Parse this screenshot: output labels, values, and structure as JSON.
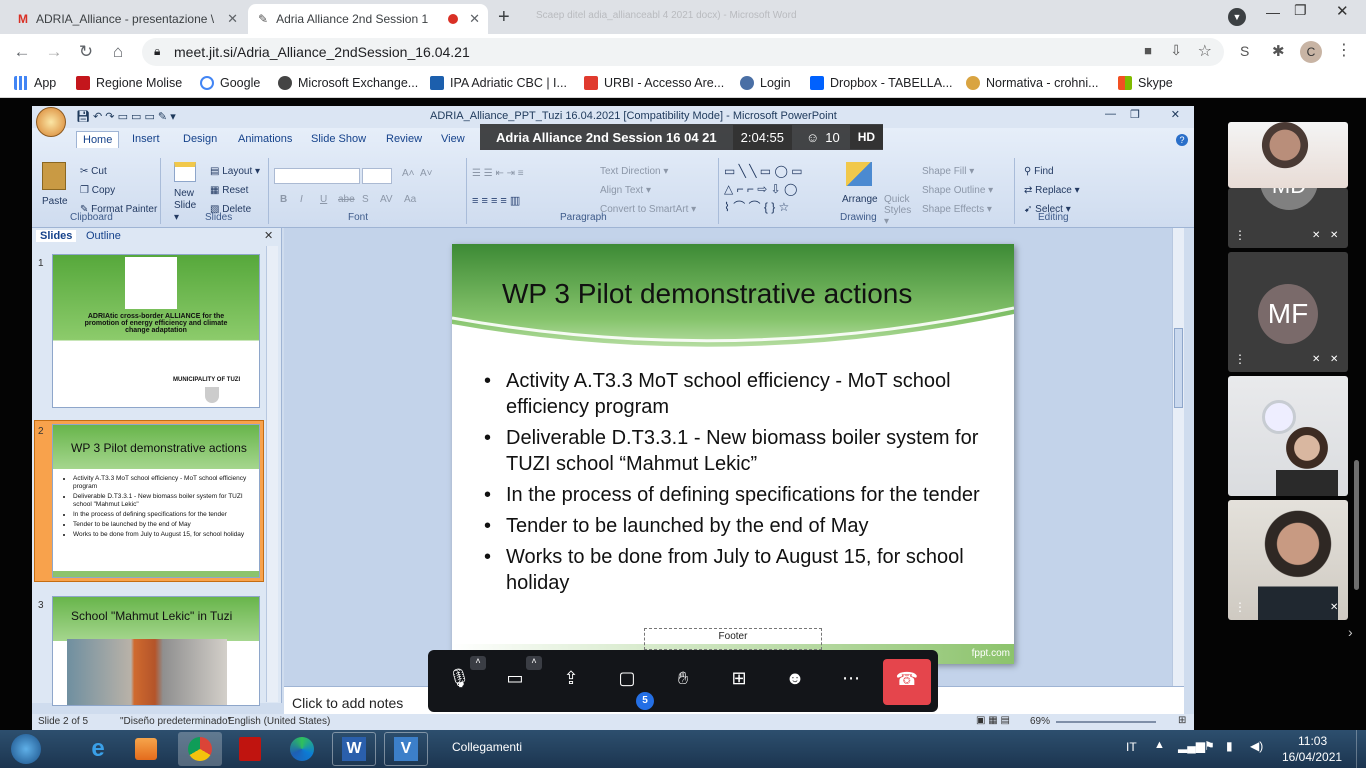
{
  "browser": {
    "tabs": [
      {
        "title": "ADRIA_Alliance - presentazione \\"
      },
      {
        "title": "Adria Alliance 2nd Session 1"
      }
    ],
    "background_window_text": "Scaep ditel adia_allianceabl 4 2021 docx) - Microsoft Word",
    "url": "meet.jit.si/Adria_Alliance_2ndSession_16.04.21",
    "profile_initial": "C",
    "bookmarks": [
      "App",
      "Regione Molise",
      "Google",
      "Microsoft Exchange...",
      "IPA Adriatic CBC | I...",
      "URBI - Accesso Are...",
      "Login",
      "Dropbox - TABELLA...",
      "Normativa - crohni...",
      "Skype"
    ]
  },
  "meeting": {
    "title": "Adria Alliance 2nd Session 16 04 21",
    "duration": "2:04:55",
    "participant_count": "10",
    "quality": "HD",
    "chat_badge": "5",
    "participants": [
      {
        "initials": "MD"
      },
      {
        "initials": "MF"
      }
    ]
  },
  "powerpoint": {
    "window_title": "ADRIA_Alliance_PPT_Tuzi 16.04.2021 [Compatibility Mode] - Microsoft PowerPoint",
    "ribbon_tabs": [
      "Home",
      "Insert",
      "Design",
      "Animations",
      "Slide Show",
      "Review",
      "View"
    ],
    "clipboard": {
      "paste": "Paste",
      "cut": "Cut",
      "copy": "Copy",
      "format_painter": "Format Painter",
      "label": "Clipboard"
    },
    "slides_group": {
      "new_slide": "New Slide ▾",
      "layout": "Layout ▾",
      "reset": "Reset",
      "delete": "Delete",
      "label": "Slides"
    },
    "font_group": {
      "label": "Font",
      "bold": "B",
      "italic": "I",
      "underline": "U",
      "strike": "abe",
      "shadow": "S",
      "spacing": "AV",
      "case": "Aa",
      "grow": "A",
      "shrink": "A"
    },
    "paragraph_group": {
      "label": "Paragraph",
      "text_direction": "Text Direction ▾",
      "align_text": "Align Text ▾",
      "smartart": "Convert to SmartArt ▾"
    },
    "drawing_group": {
      "label": "Drawing",
      "arrange": "Arrange",
      "quick_styles": "Quick Styles ▾",
      "shape_fill": "Shape Fill ▾",
      "shape_outline": "Shape Outline ▾",
      "shape_effects": "Shape Effects ▾"
    },
    "editing_group": {
      "label": "Editing",
      "find": "Find",
      "replace": "Replace ▾",
      "select": "Select ▾"
    },
    "panel_tabs": [
      "Slides",
      "Outline"
    ],
    "thumbnails": [
      {
        "number": "1",
        "title": "ADRIAtic cross-border ALLIANCE for the promotion of energy efficiency and climate change adaptation",
        "footer": "MUNICIPALITY OF TUZI"
      },
      {
        "number": "2",
        "title": "WP 3 Pilot demonstrative actions",
        "bullets": [
          "Activity A.T3.3 MoT school efficiency - MoT school efficiency program",
          "Deliverable D.T3.3.1 - New biomass boiler system for TUZI school \"Mahmut Lekic\"",
          "In the process of defining specifications for the tender",
          "Tender to be launched by the end of May",
          "Works to be done from July to August 15, for school holiday"
        ]
      },
      {
        "number": "3",
        "title": "School \"Mahmut Lekic\" in Tuzi"
      }
    ],
    "slide": {
      "title": "WP 3 Pilot demonstrative actions",
      "bullets": [
        "Activity A.T3.3 MoT school efficiency - MoT school efficiency program",
        "Deliverable D.T3.3.1 - New biomass boiler system for TUZI school “Mahmut Lekic”",
        "In the process of defining specifications for the tender",
        "Tender to be launched by the end of May",
        "Works to be done from July to August 15, for school holiday"
      ],
      "footer": "Footer",
      "brand": "fppt.com"
    },
    "notes_placeholder": "Click to add notes",
    "status": {
      "slide": "Slide 2 of 5",
      "theme": "\"Diseño predeterminado\"",
      "language": "English (United States)",
      "zoom": "69%"
    }
  },
  "taskbar": {
    "window_label": "Collegamenti",
    "lang": "IT",
    "time": "11:03",
    "date": "16/04/2021"
  }
}
